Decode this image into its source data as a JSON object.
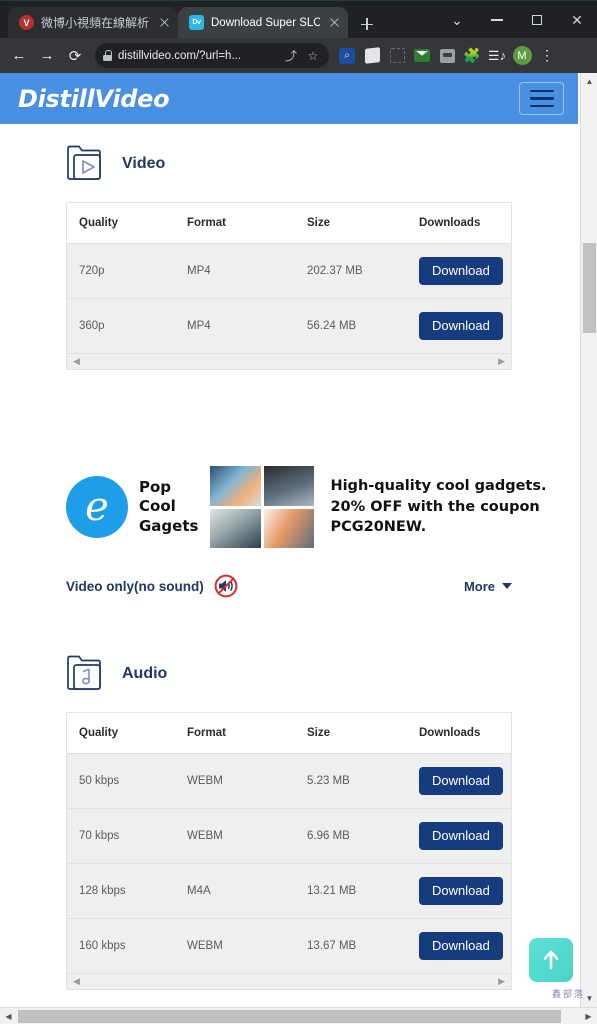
{
  "browser": {
    "tabs": [
      {
        "title": "微博小視頻在線解析下載",
        "favicon": "weibo-icon",
        "active": false
      },
      {
        "title": "Download Super SLOW",
        "favicon": "dv-icon",
        "active": true
      }
    ],
    "new_tab_label": "+",
    "window_controls": [
      "chevron-down-icon",
      "minimize-icon",
      "maximize-icon",
      "close-icon"
    ],
    "nav": {
      "back": "←",
      "forward": "→",
      "reload": "⟳"
    },
    "omnibox": {
      "url": "distillvideo.com/?url=h...",
      "lock": "lock-icon",
      "share": "share-icon",
      "bookmark": "star-icon"
    },
    "toolbar_icons": [
      "search-highlight-icon",
      "paper-stack-icon",
      "dashed-capture-icon",
      "mail-icon",
      "clipboard-robot-icon",
      "puzzle-extension-icon",
      "playlist-music-icon"
    ],
    "profile_initial": "M",
    "menu": "⋮"
  },
  "site": {
    "logo": "DistillVideo",
    "menu_button": "hamburger-icon",
    "accent_color": "#4a90e2",
    "button_color": "#173b7f",
    "heading_color": "#1f3864"
  },
  "video_section": {
    "title": "Video",
    "icon": "folder-video-icon",
    "columns": [
      "Quality",
      "Format",
      "Size",
      "Downloads"
    ],
    "rows": [
      {
        "quality": "720p",
        "format": "MP4",
        "size": "202.37 MB",
        "action": "Download"
      },
      {
        "quality": "360p",
        "format": "MP4",
        "size": "56.24 MB",
        "action": "Download"
      }
    ]
  },
  "ad": {
    "logo_glyph": "e",
    "brand_lines": "Pop\nCool\nGagets",
    "brand_line1": "Pop",
    "brand_line2": "Cool",
    "brand_line3": "Gagets",
    "text_line1": "High-quality cool gadgets.",
    "text_line2": "20% OFF with the coupon",
    "text_line3": "PCG20NEW."
  },
  "video_only": {
    "label": "Video only(no sound)",
    "icon": "muted-speaker-icon",
    "more_label": "More",
    "more_caret": "chevron-down-icon"
  },
  "audio_section": {
    "title": "Audio",
    "icon": "folder-audio-icon",
    "columns": [
      "Quality",
      "Format",
      "Size",
      "Downloads"
    ],
    "rows": [
      {
        "quality": "50 kbps",
        "format": "WEBM",
        "size": "5.23 MB",
        "action": "Download"
      },
      {
        "quality": "70 kbps",
        "format": "WEBM",
        "size": "6.96 MB",
        "action": "Download"
      },
      {
        "quality": "128 kbps",
        "format": "M4A",
        "size": "13.21 MB",
        "action": "Download"
      },
      {
        "quality": "160 kbps",
        "format": "WEBM",
        "size": "13.67 MB",
        "action": "Download"
      }
    ]
  },
  "floating": {
    "scroll_top": "scroll-to-top-icon",
    "watermark": "鑫部落"
  }
}
